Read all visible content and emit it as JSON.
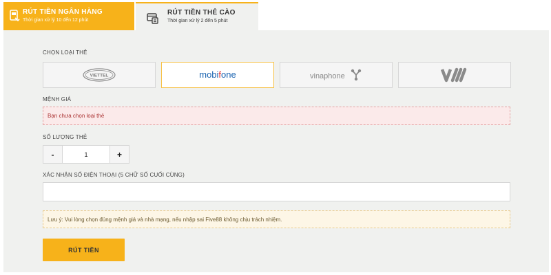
{
  "tabs": [
    {
      "title": "RÚT TIỀN NGÂN HÀNG",
      "subtitle": "Thời gian xử lý 10 đến 12 phút",
      "icon": "bank-withdraw-icon"
    },
    {
      "title": "RÚT TIỀN THẺ CÀO",
      "subtitle": "Thời gian xử lý 2 đến 5 phút",
      "icon": "card-withdraw-icon"
    }
  ],
  "form": {
    "card_type_label": "CHỌN LOẠI THẺ",
    "cards": [
      {
        "name": "VIETTEL"
      },
      {
        "name": "mobifone"
      },
      {
        "name": "vinaphone"
      },
      {
        "name": "vietnamobile"
      }
    ],
    "selected_card": "mobifone",
    "denomination_label": "MỆNH GIÁ",
    "denomination_error": "Bạn chưa chọn loại thẻ",
    "quantity_label": "SỐ LƯỢNG THẺ",
    "quantity_minus": "-",
    "quantity_value": "1",
    "quantity_plus": "+",
    "phone_label": "XÁC NHẬN SỐ ĐIỆN THOẠI (5 CHỮ SỐ CUỐI CÙNG)",
    "phone_value": "",
    "note": "Lưu ý: Vui lòng chọn đúng mệnh giá và nhà mạng, nếu nhập sai Five88 không chịu trách nhiệm.",
    "submit_label": "RÚT TIỀN"
  },
  "colors": {
    "accent": "#f7b21a",
    "panel_bg": "#f0f1ef",
    "error_bg": "#fbeaea",
    "error_text": "#aa3333",
    "note_bg": "#fdf6e6",
    "mobifone_blue": "#1a63b0",
    "mobifone_red": "#e32626",
    "vinaphone_gray": "#8a8a8a"
  }
}
